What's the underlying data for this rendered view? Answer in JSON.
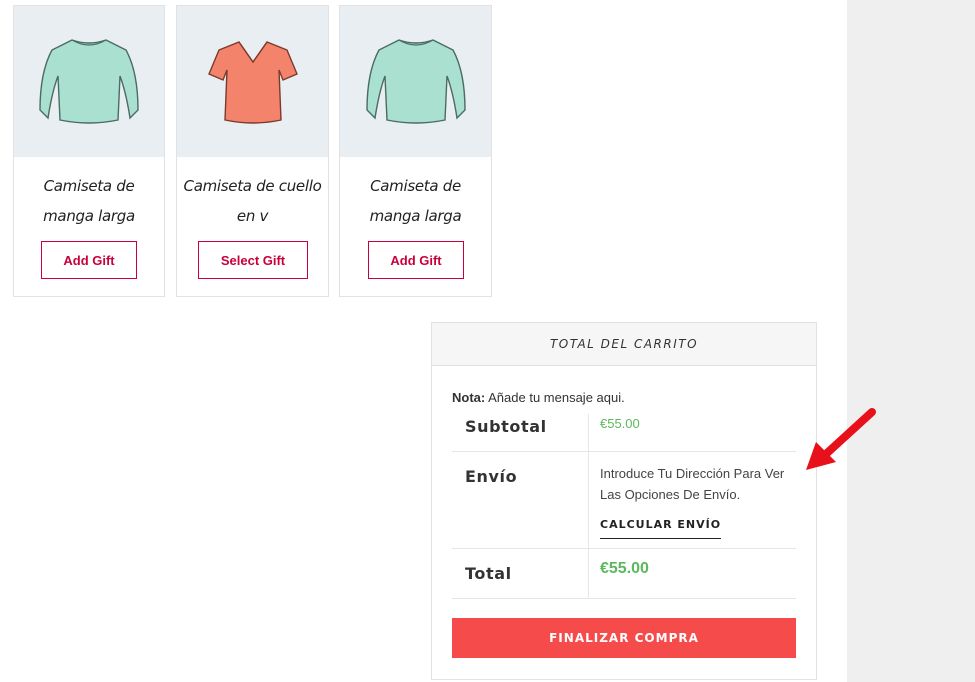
{
  "products": [
    {
      "name": "Camiseta de manga larga",
      "button": "Add Gift",
      "icon": "long-sleeve-shirt-icon",
      "color": "#a9e0cf"
    },
    {
      "name": "Camiseta de cuello en v",
      "button": "Select Gift",
      "icon": "v-neck-tshirt-icon",
      "color": "#f4836b"
    },
    {
      "name": "Camiseta de manga larga",
      "button": "Add Gift",
      "icon": "long-sleeve-shirt-icon",
      "color": "#a9e0cf"
    }
  ],
  "cart": {
    "title": "TOTAL DEL CARRITO",
    "note_label": "Nota:",
    "note_text": "Añade tu mensaje aqui.",
    "subtotal_label": "Subtotal",
    "subtotal_value": "€55.00",
    "shipping_label": "Envío",
    "shipping_text": "Introduce Tu Dirección Para Ver Las Opciones De Envío.",
    "calc_shipping": "CALCULAR ENVÍO",
    "total_label": "Total",
    "total_value": "€55.00",
    "checkout": "FINALIZAR COMPRA"
  },
  "colors": {
    "accent": "#c8003c",
    "price": "#5cb85c",
    "checkout": "#f54b4b",
    "annotation_arrow": "#e8101a"
  }
}
